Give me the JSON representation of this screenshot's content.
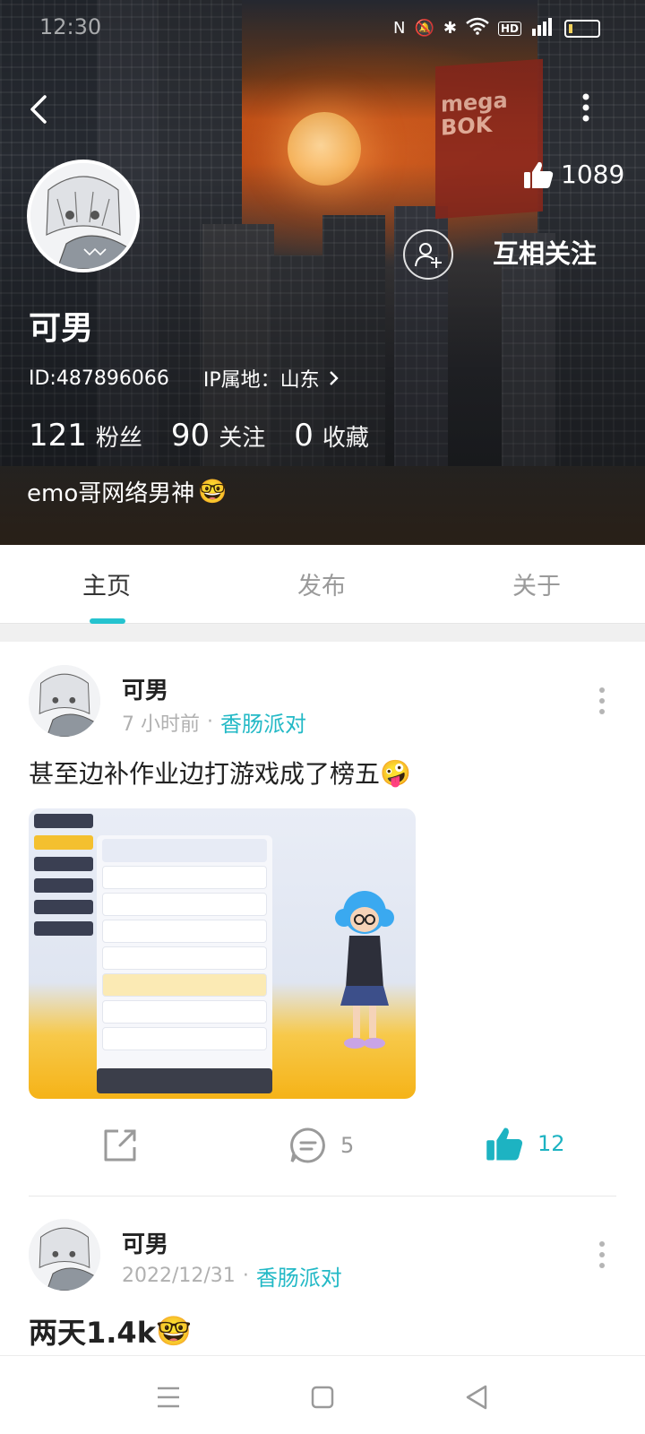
{
  "status_bar": {
    "time": "12:30"
  },
  "profile": {
    "likes_total": "1089",
    "mutual_follow_label": "互相关注",
    "name": "可男",
    "id_text": "ID:487896066",
    "ip_text": "IP属地：山东",
    "stats": [
      {
        "value": "121",
        "label": "粉丝"
      },
      {
        "value": "90",
        "label": "关注"
      },
      {
        "value": "0",
        "label": "收藏"
      }
    ],
    "bio": "emo哥网络男神",
    "bio_emoji": "🤓"
  },
  "tabs": [
    {
      "label": "主页",
      "active": true
    },
    {
      "label": "发布",
      "active": false
    },
    {
      "label": "关于",
      "active": false
    }
  ],
  "posts": [
    {
      "author": "可男",
      "time": "7 小时前",
      "topic": "香肠派对",
      "text": "甚至边补作业边打游戏成了榜五",
      "text_emoji": "🤪",
      "comments": "5",
      "likes": "12"
    },
    {
      "author": "可男",
      "time": "2022/12/31",
      "topic": "香肠派对",
      "text": "两天1.4k",
      "text_emoji": "🤓"
    }
  ],
  "colors": {
    "accent": "#25c3cf",
    "topic": "#23b9c6",
    "liked": "#1db3c2"
  }
}
